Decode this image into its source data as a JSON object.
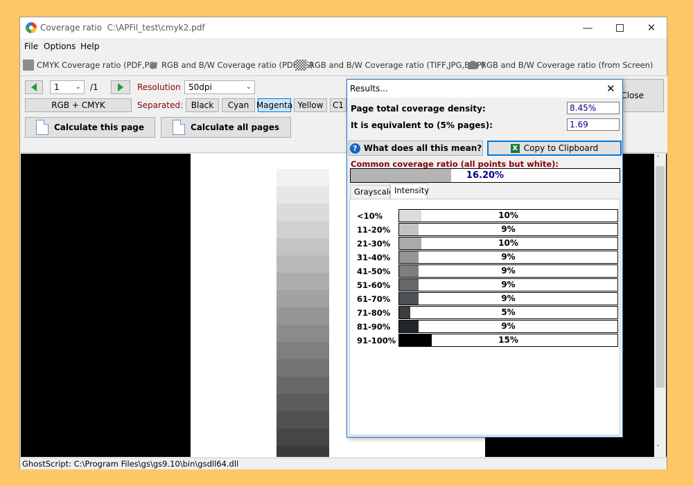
{
  "window": {
    "title": "Coverage ratio",
    "path": "C:\\APFil_test\\cmyk2.pdf"
  },
  "menu": [
    "File",
    "Options",
    "Help"
  ],
  "toolbar": [
    {
      "label": "CMYK Coverage ratio  (PDF,PS)",
      "icon": "cmyk-icon"
    },
    {
      "label": "RGB and B/W Coverage ratio (PDF,PS)",
      "icon": "rgb-pdf-icon"
    },
    {
      "label": "RGB and B/W Coverage ratio (TIFF,JPG,BMP)",
      "icon": "image-icon"
    },
    {
      "label": "RGB and B/W Coverage ratio (from Screen)",
      "icon": "screen-icon"
    }
  ],
  "controls": {
    "page_value": "1",
    "page_total": "/1",
    "resolution_label": "Resolution",
    "resolution_value": "50dpi",
    "mode_button": "RGB + CMYK",
    "separated_label": "Separated:",
    "separations": [
      "Black",
      "Cyan",
      "Magenta",
      "Yellow",
      "C1"
    ],
    "calc_page": "Calculate this page",
    "calc_all": "Calculate all pages",
    "close": "Close"
  },
  "status": "GhostScript: C:\\Program Files\\gs\\gs9.10\\bin\\gsdll64.dll",
  "results": {
    "title": "Results...",
    "density_label": "Page total coverage density:",
    "density_value": "8.45%",
    "equiv_label": "It is equivalent to (5% pages):",
    "equiv_value": "1.69",
    "help_button": "What does all this mean?",
    "copy_button": "Copy to Clipboard",
    "common_label": "Common coverage ratio (all points but white):",
    "common_value": "16.20%",
    "common_fraction": 0.162,
    "tabs": [
      "Grayscale",
      "Intensity"
    ],
    "active_tab": "Intensity",
    "rows": [
      {
        "label": "<10%",
        "value": "10%",
        "fraction": 0.1,
        "color": "#dcdcdc"
      },
      {
        "label": "11-20%",
        "value": "9%",
        "fraction": 0.09,
        "color": "#c4c4c4"
      },
      {
        "label": "21-30%",
        "value": "10%",
        "fraction": 0.1,
        "color": "#aaaaaa"
      },
      {
        "label": "31-40%",
        "value": "9%",
        "fraction": 0.09,
        "color": "#949494"
      },
      {
        "label": "41-50%",
        "value": "9%",
        "fraction": 0.09,
        "color": "#7e7e7e"
      },
      {
        "label": "51-60%",
        "value": "9%",
        "fraction": 0.09,
        "color": "#686868"
      },
      {
        "label": "61-70%",
        "value": "9%",
        "fraction": 0.09,
        "color": "#4e5256"
      },
      {
        "label": "71-80%",
        "value": "5%",
        "fraction": 0.05,
        "color": "#3a3d40"
      },
      {
        "label": "81-90%",
        "value": "9%",
        "fraction": 0.09,
        "color": "#24272a"
      },
      {
        "label": "91-100%",
        "value": "15%",
        "fraction": 0.15,
        "color": "#000000"
      }
    ]
  }
}
